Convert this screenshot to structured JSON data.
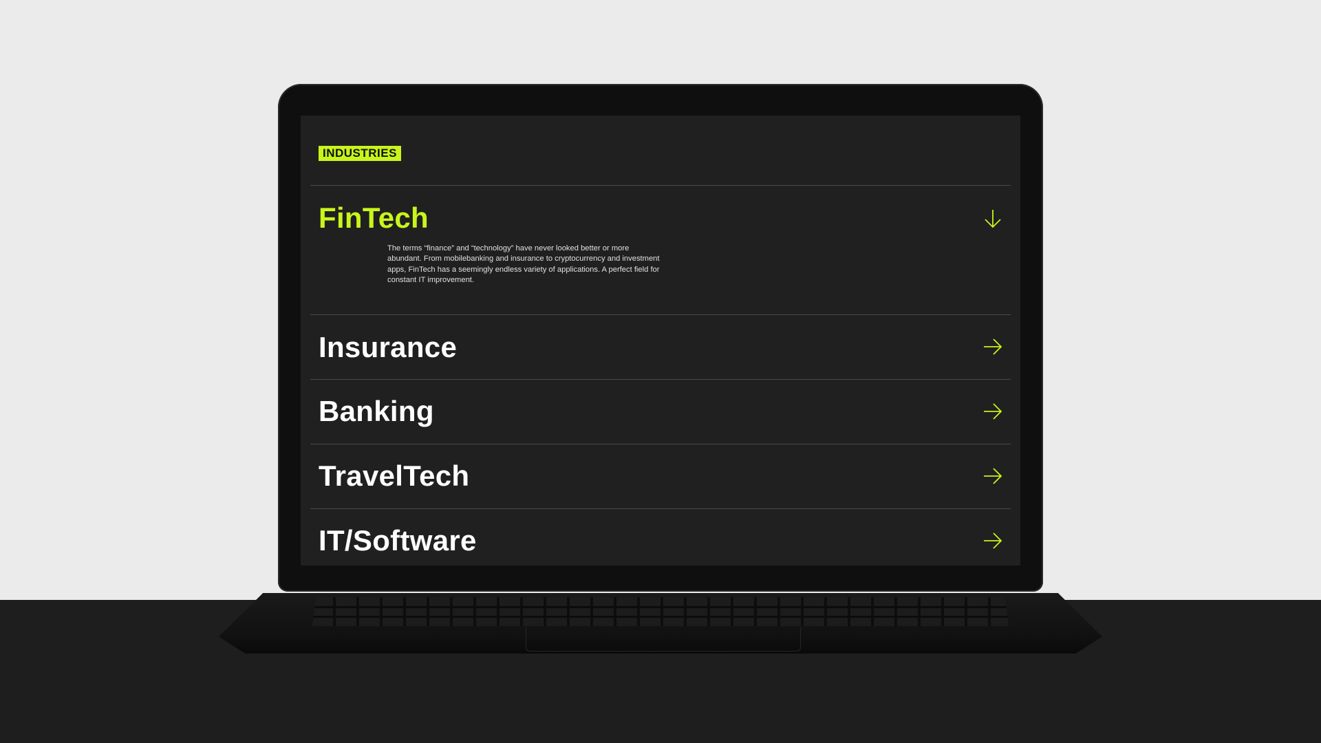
{
  "section_tag": "INDUSTRIES",
  "accent_color": "#c8f51b",
  "industries": [
    {
      "title": "FinTech",
      "expanded": true,
      "icon": "arrow-down-icon",
      "description": "The terms “finance” and “technology” have never looked better or more abundant. From mobilebanking and insurance to cryptocurrency and investment apps, FinTech has a seemingly endless variety of applications. A perfect field for constant IT improvement."
    },
    {
      "title": "Insurance",
      "expanded": false,
      "icon": "arrow-right-icon"
    },
    {
      "title": "Banking",
      "expanded": false,
      "icon": "arrow-right-icon"
    },
    {
      "title": "TravelTech",
      "expanded": false,
      "icon": "arrow-right-icon"
    },
    {
      "title": "IT/Software",
      "expanded": false,
      "icon": "arrow-right-icon"
    }
  ]
}
